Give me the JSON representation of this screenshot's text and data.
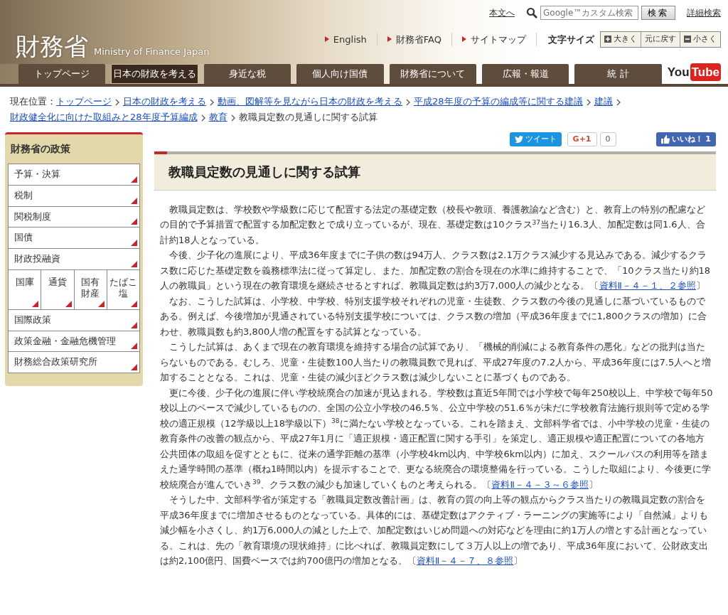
{
  "header": {
    "logo": "財務省",
    "logo_sub": "Ministry of Finance Japan",
    "skip_link": "本文へ",
    "search": {
      "placeholder": "Google™カスタム検索",
      "button": "検索"
    },
    "advanced_search": "詳細検索",
    "links": [
      "English",
      "財務省FAQ",
      "サイトマップ"
    ],
    "font_size": {
      "label": "文字サイズ",
      "buttons": [
        {
          "kind": "plus",
          "label": "大きく"
        },
        {
          "kind": "reset",
          "label": "元に戻す"
        },
        {
          "kind": "minus",
          "label": "小さく"
        }
      ]
    }
  },
  "nav": {
    "tabs": [
      {
        "label": "トップページ",
        "selected": false
      },
      {
        "label": "日本の財政を考える",
        "selected": true
      },
      {
        "label": "身近な税",
        "selected": false
      },
      {
        "label": "個人向け国債",
        "selected": false
      },
      {
        "label": "財務省について",
        "selected": false
      },
      {
        "label": "広報・報道",
        "selected": false
      },
      {
        "label": "統 計",
        "selected": false
      }
    ],
    "youtube": {
      "you": "You",
      "tube": "Tube"
    }
  },
  "breadcrumb": {
    "label": "現在位置：",
    "links": [
      "トップページ",
      "日本の財政を考える",
      "動画、図解等を見ながら日本の財政を考える",
      "平成28年度の予算の編成等に関する建議",
      "建議",
      "財政健全化に向けた取組みと28年度予算編成",
      "教育"
    ],
    "current": "教職員定数の見通しに関する試算"
  },
  "sidebar": {
    "title": "財務省の政策",
    "items": [
      {
        "kind": "row",
        "lines": [
          "予算・決算"
        ]
      },
      {
        "kind": "row",
        "lines": [
          "税制"
        ]
      },
      {
        "kind": "row",
        "lines": [
          "関税制度"
        ]
      },
      {
        "kind": "row",
        "lines": [
          "国債"
        ]
      },
      {
        "kind": "row",
        "lines": [
          "財政投融資"
        ]
      },
      {
        "kind": "cell",
        "lines": [
          "国庫"
        ]
      },
      {
        "kind": "cell",
        "lines": [
          "通貨"
        ]
      },
      {
        "kind": "cell",
        "lines": [
          "国有",
          "財産"
        ]
      },
      {
        "kind": "cell",
        "lines": [
          "たばこ",
          "塩"
        ]
      },
      {
        "kind": "row",
        "lines": [
          "国際政策"
        ]
      },
      {
        "kind": "row",
        "lines": [
          "政策金融・金融危機管理"
        ]
      },
      {
        "kind": "row",
        "lines": [
          "財務総合政策研究所"
        ]
      }
    ]
  },
  "social": {
    "tweet": "ツイート",
    "gplus": "G+1",
    "gplus_count": "0",
    "like": "いいね！",
    "like_count": "1"
  },
  "article": {
    "title": "教職員定数の見通しに関する試算",
    "paragraphs": [
      {
        "parts": [
          {
            "kind": "text",
            "text": "教職員定数は、学校数や学級数に応じて配置する法定の基礎定数（校長や教頭、養護教諭など含む）と、教育上の特別の配慮などの目的で予算措置で配置する加配定数とで成り立っているが、現在、基礎定数は10クラス$^{37}$当たり16.3人、加配定数は同1.6人、合計約18人となっている。"
          }
        ]
      },
      {
        "parts": [
          {
            "kind": "text",
            "text": "今後、少子化の進展により、平成36年度までに子供の数は94万人、クラス数は2.1万クラス減少する見込みである。減少するクラス数に応じた基礎定数を義務標準法に従って算定し、また、加配定数の割合を現在の水準に維持することで、「10クラス当たり約18人の教職員」という現在の教育環境を継続させるとすれば、教職員定数は約3万7,000人の減少となる。〔"
          },
          {
            "kind": "link",
            "text": "資料Ⅱ－４－１、２参照"
          },
          {
            "kind": "text",
            "text": "〕"
          }
        ]
      },
      {
        "parts": [
          {
            "kind": "text",
            "text": "なお、こうした試算は、小学校、中学校、特別支援学校それぞれの児童・生徒数、クラス数の今後の見通しに基づいているものである。例えば、今後増加が見通されている特別支援学校については、クラス数の増加（平成36年度までに1,800クラスの増加）に合わせ、教職員数も約3,800人増の配置をする試算となっている。"
          }
        ]
      },
      {
        "parts": [
          {
            "kind": "text",
            "text": "こうした試算は、あくまで現在の教育環境を維持する場合の試算であり、「機械的削減による教育条件の悪化」などの批判は当たらないものである。むしろ、児童・生徒数100人当たりの教職員数で見れば、平成27年度の7.2人から、平成36年度には7.5人へと増加することとなる。これは、児童・生徒の減少ほどクラス数は減少しないことに基づくものである。"
          }
        ]
      },
      {
        "parts": [
          {
            "kind": "text",
            "text": "更に今後、少子化の進展に伴い学校統廃合の加速が見込まれる。学校数は直近5年間では小学校で毎年250校以上、中学校で毎年50校以上のペースで減少しているものの、全国の公立小学校の46.5％、公立中学校の51.6％が未だに学校教育法施行規則等で定める学校の適正規模（12学級以上18学級以下）$^{38}$に満たない学校となっている。これを踏まえ、文部科学省では、小中学校の児童・生徒の教育条件の改善の観点から、平成27年1月に「適正規模・適正配置に関する手引」を策定し、適正規模や適正配置についての各地方公共団体の取組を促すとともに、従来の通学距離の基準（小学校4km以内、中学校6km以内）に加え、スクールバスの利用等を踏まえた通学時間の基準（概ね1時間以内）を提示することで、更なる統廃合の環境整備を行っている。こうした取組により、今後更に学校統廃合が進んでいき$^{39}$、クラス数の減少も加速していくものと考えられる。〔"
          },
          {
            "kind": "link",
            "text": "資料Ⅱ－４－３～６参照"
          },
          {
            "kind": "text",
            "text": "〕"
          }
        ]
      },
      {
        "parts": [
          {
            "kind": "text",
            "text": "そうした中、文部科学省が策定する「教職員定数改善計画」は、教育の質の向上等の観点からクラス当たりの教職員定数の割合を平成36年度までに増加させるものとなっている。具体的には、基礎定数はアクティブ・ラーニングの実施等により「自然減」よりも減少幅を小さくし、約1万6,000人の減とした上で、加配定数はいじめ問題への対応などを理由に約1万人の増とする計画となっている。これは、先の「教育環境の現状維持」に比べれば、教職員定数にして３万人以上の増であり、平成36年度において、公財政支出は約2,100億円、国費ベースでは約700億円の増加となる。〔"
          },
          {
            "kind": "link",
            "text": "資料Ⅱ－４－７、８参照"
          },
          {
            "kind": "text",
            "text": "〕"
          }
        ]
      }
    ]
  }
}
